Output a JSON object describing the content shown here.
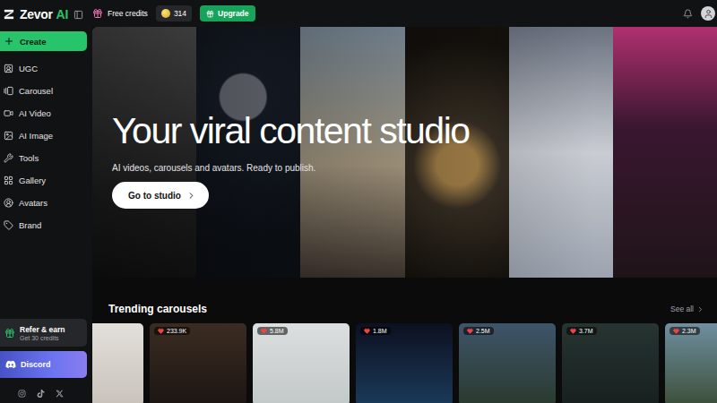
{
  "logo": {
    "name": "Zevor",
    "accent": "AI"
  },
  "sidebar": {
    "create": "Create",
    "items": [
      {
        "label": "UGC",
        "selected": false
      },
      {
        "label": "Carousel",
        "selected": false
      },
      {
        "label": "AI Video",
        "selected": false
      },
      {
        "label": "AI Image",
        "selected": false
      },
      {
        "label": "Tools",
        "selected": false
      },
      {
        "label": "Gallery",
        "selected": false
      },
      {
        "label": "Avatars",
        "selected": false
      },
      {
        "label": "Brand",
        "selected": false
      }
    ],
    "refer": {
      "title": "Refer & earn",
      "subtitle": "Get 30 credits"
    },
    "discord": {
      "label": "Discord"
    }
  },
  "topbar": {
    "free_credits": "Free credits",
    "credits": "314",
    "upgrade": "Upgrade"
  },
  "hero": {
    "title": "Your viral content studio",
    "subtitle": "AI videos, carousels and avatars. Ready to publish.",
    "button": "Go to studio"
  },
  "trending": {
    "title": "Trending carousels",
    "see_all": "See all",
    "cards": [
      {
        "views": ""
      },
      {
        "views": "233.9K"
      },
      {
        "views": "5.8M"
      },
      {
        "views": "1.8M"
      },
      {
        "views": "2.5M"
      },
      {
        "views": "3.7M"
      },
      {
        "views": "2.3M"
      }
    ]
  }
}
